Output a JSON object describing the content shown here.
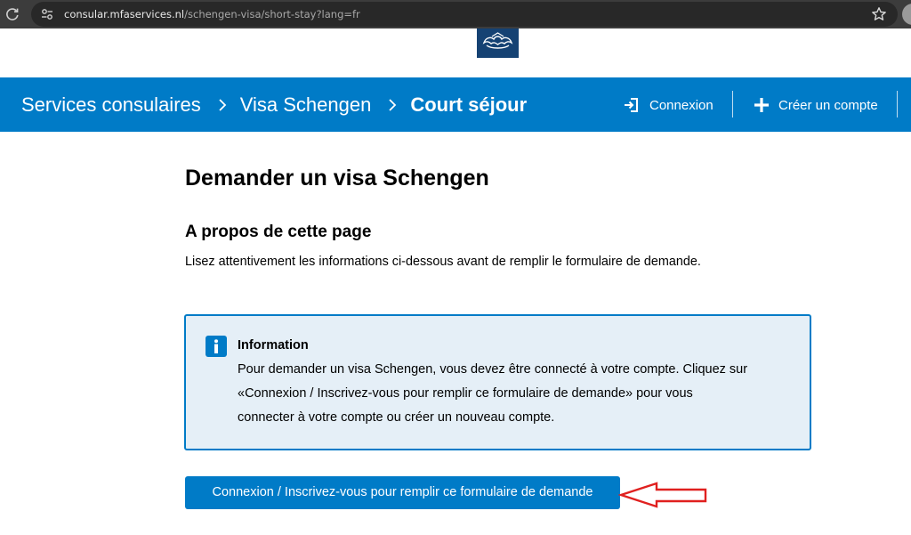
{
  "browser": {
    "url_host": "consular.mfaservices.nl",
    "url_path": "/schengen-visa/short-stay?lang=fr"
  },
  "header": {
    "breadcrumb": [
      "Services consulaires",
      "Visa Schengen",
      "Court séjour"
    ],
    "login_label": "Connexion",
    "register_label": "Créer un compte"
  },
  "main": {
    "title": "Demander un visa Schengen",
    "section_title": "A propos de cette page",
    "section_desc": "Lisez attentivement les informations ci-dessous avant de remplir le formulaire de demande.",
    "info": {
      "heading": "Information",
      "lines": [
        "Pour demander un visa Schengen, vous devez être connecté à votre compte. Cliquez sur",
        "«Connexion / Inscrivez-vous pour remplir ce formulaire de demande» pour vous",
        "connecter à votre compte ou créer un nouveau compte."
      ]
    },
    "apply_button_label": "Connexion / Inscrivez-vous pour remplir ce formulaire de demande"
  },
  "colors": {
    "header_blue": "#007bc7",
    "info_background": "#e5eff7",
    "annotation_red": "#e0201f"
  },
  "icons": [
    "reload-icon",
    "site-settings-icon",
    "star-icon",
    "logo-emblem",
    "chevron-right-icon",
    "login-icon",
    "plus-icon",
    "info-icon",
    "arrow-annotation"
  ]
}
